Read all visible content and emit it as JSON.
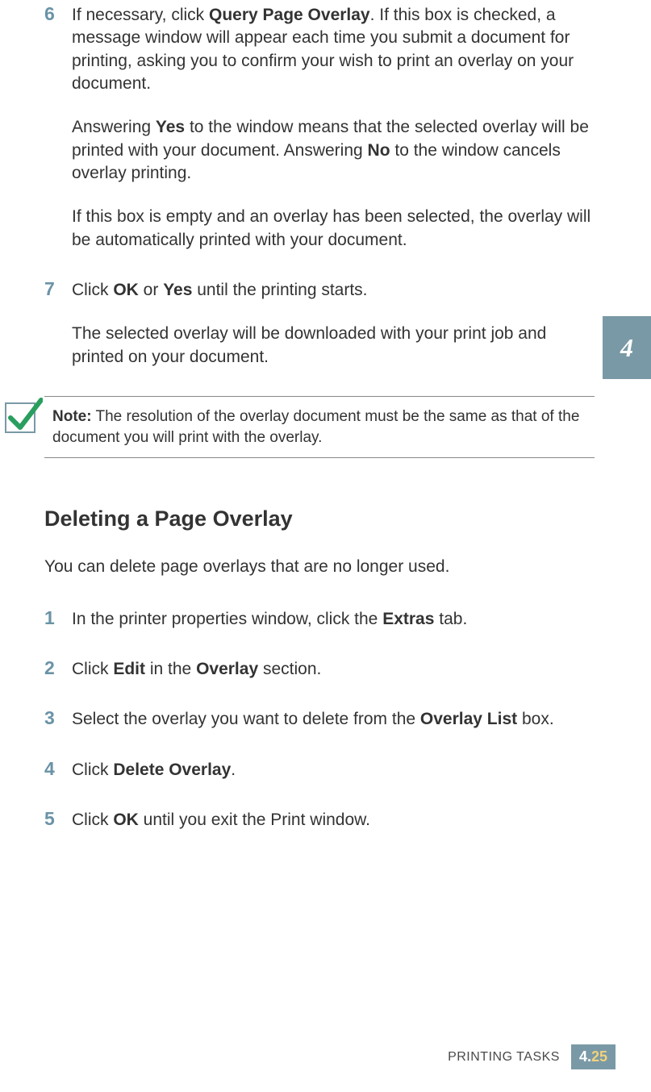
{
  "chapter": {
    "tab_number": "4",
    "footer_label": "PRINTING TASKS",
    "footer_chapter": "4.",
    "footer_page": "25"
  },
  "steps_top": {
    "s6": {
      "num": "6",
      "p1_a": "If necessary, click ",
      "p1_b": "Query Page Overlay",
      "p1_c": ". If this box is checked, a message window will appear each time you submit a document for printing, asking you to confirm your wish to print an overlay on your document.",
      "p2_a": "Answering ",
      "p2_b": "Yes",
      "p2_c": " to the window means that the selected overlay will be printed with your document. Answering ",
      "p2_d": "No",
      "p2_e": " to the window cancels overlay printing.",
      "p3": "If this box is empty and an overlay has been selected, the overlay will be automatically printed with your document."
    },
    "s7": {
      "num": "7",
      "p1_a": "Click ",
      "p1_b": "OK",
      "p1_c": " or ",
      "p1_d": "Yes",
      "p1_e": " until the printing starts.",
      "p2": "The selected overlay will be downloaded with your print job and printed on your document."
    }
  },
  "note": {
    "label": "Note:",
    "text": " The resolution of the overlay document must be the same as that of the document you will print with the overlay."
  },
  "section": {
    "heading": "Deleting a Page Overlay",
    "intro": "You can delete page overlays that are no longer used."
  },
  "steps_bottom": {
    "s1": {
      "num": "1",
      "a": "In the printer properties window, click the ",
      "b": "Extras",
      "c": " tab."
    },
    "s2": {
      "num": "2",
      "a": "Click ",
      "b": "Edit",
      "c": " in the ",
      "d": "Overlay",
      "e": " section."
    },
    "s3": {
      "num": "3",
      "a": "Select the overlay you want to delete from the ",
      "b": "Overlay List",
      "c": " box."
    },
    "s4": {
      "num": "4",
      "a": "Click ",
      "b": "Delete Overlay",
      "c": "."
    },
    "s5": {
      "num": "5",
      "a": "Click ",
      "b": "OK",
      "c": " until you exit the Print window."
    }
  }
}
